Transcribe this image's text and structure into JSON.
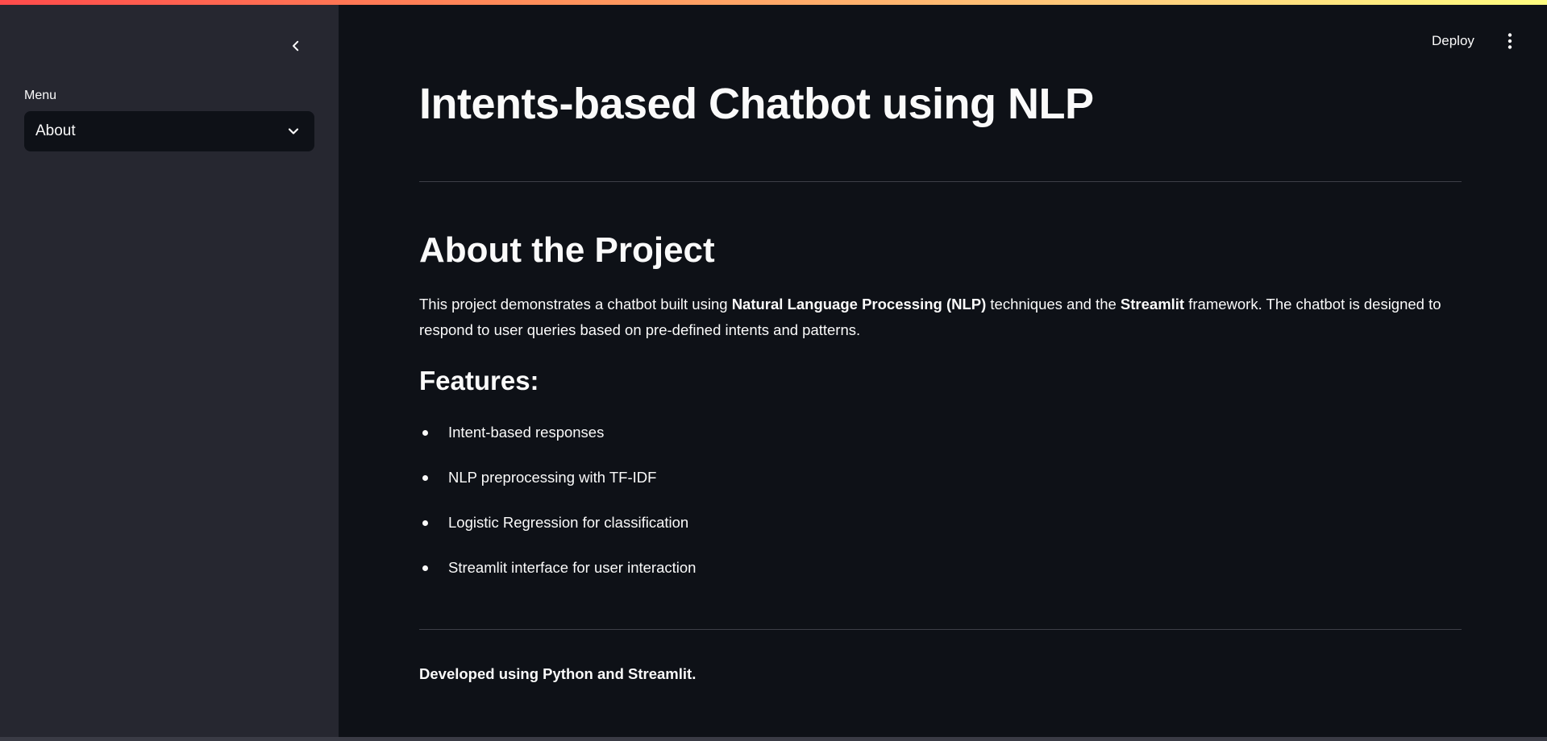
{
  "header": {
    "deploy_label": "Deploy",
    "menu_icon": "kebab-menu-icon"
  },
  "sidebar": {
    "collapse_icon": "chevron-left-icon",
    "menu_label": "Menu",
    "select": {
      "selected": "About",
      "icon": "chevron-down-icon"
    }
  },
  "main": {
    "title": "Intents-based Chatbot using NLP",
    "about": {
      "heading": "About the Project",
      "text_1": "This project demonstrates a chatbot built using ",
      "bold_1": "Natural Language Processing (NLP)",
      "text_2": " techniques and the ",
      "bold_2": "Streamlit",
      "text_3": " framework. The chatbot is designed to respond to user queries based on pre-defined intents and patterns."
    },
    "features": {
      "heading": "Features:",
      "items": [
        "Intent-based responses",
        "NLP preprocessing with TF-IDF",
        "Logistic Regression for classification",
        "Streamlit interface for user interaction"
      ]
    },
    "footer": "Developed using Python and Streamlit."
  },
  "colors": {
    "main_background": "#0e1117",
    "sidebar_background": "#262730",
    "text": "#fafafa",
    "accent_gradient_start": "#ff4b4b",
    "accent_gradient_end": "#fffd80"
  }
}
